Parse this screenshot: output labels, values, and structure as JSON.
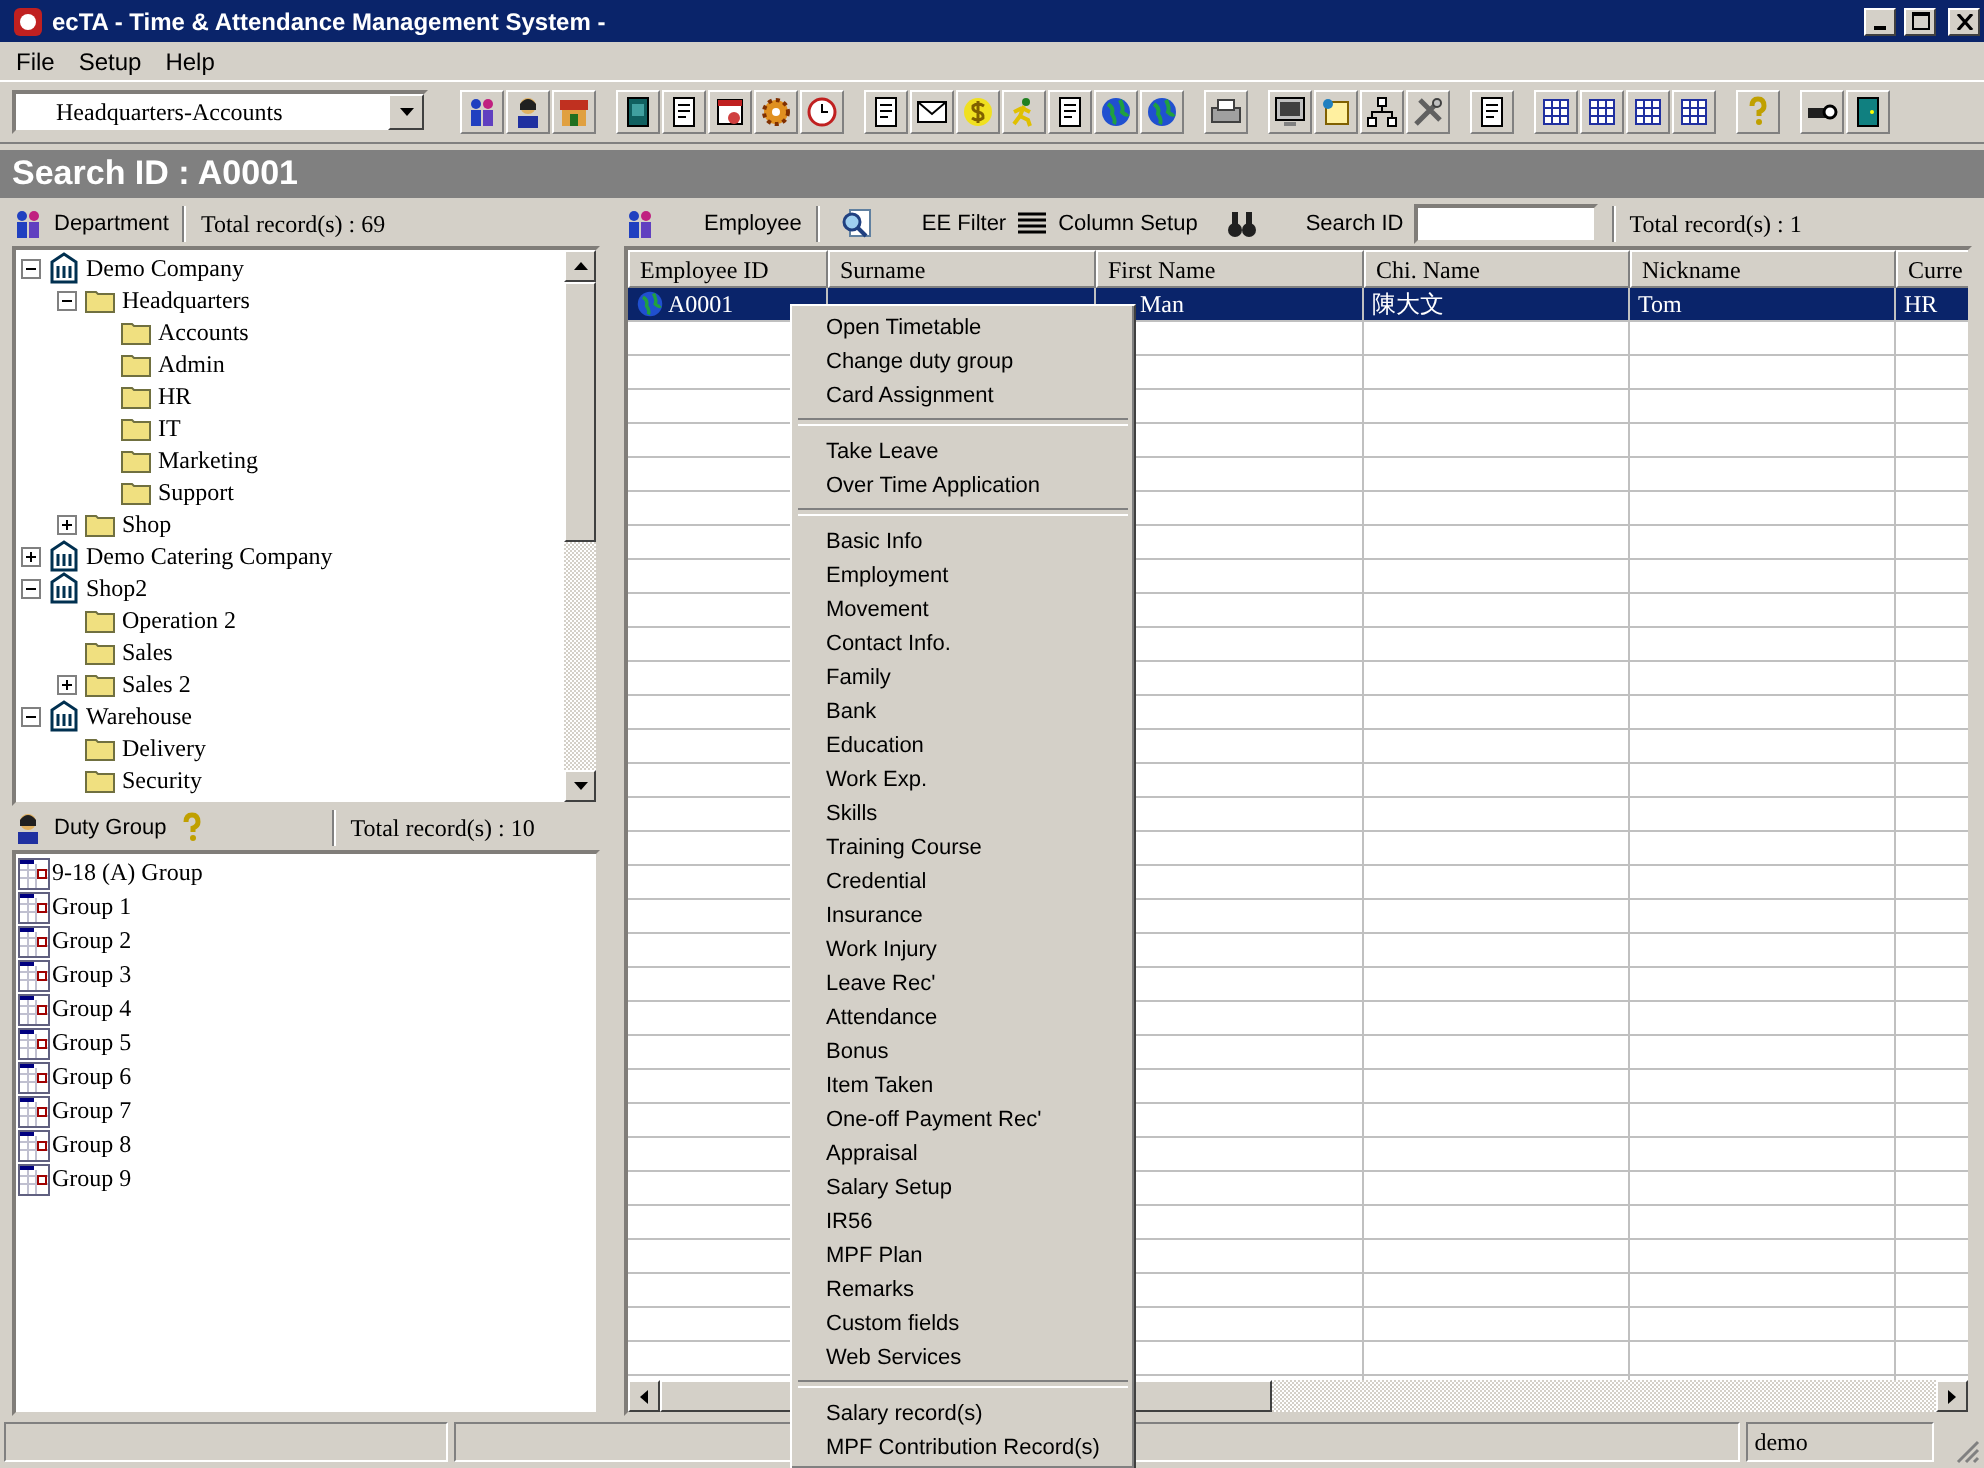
{
  "window": {
    "title": "ecTA - Time & Attendance Management System -"
  },
  "menu_bar": [
    "File",
    "Setup",
    "Help"
  ],
  "department_selector": {
    "value": "Headquarters-Accounts"
  },
  "search_header": "Search ID : A0001",
  "department_panel": {
    "label": "Department",
    "total": "Total record(s) : 69",
    "tree": [
      {
        "label": "Demo Company",
        "kind": "company",
        "expanded": true,
        "children": [
          {
            "label": "Headquarters",
            "kind": "folder",
            "expanded": true,
            "children": [
              {
                "label": "Accounts",
                "kind": "folder"
              },
              {
                "label": "Admin",
                "kind": "folder"
              },
              {
                "label": "HR",
                "kind": "folder"
              },
              {
                "label": "IT",
                "kind": "folder"
              },
              {
                "label": "Marketing",
                "kind": "folder"
              },
              {
                "label": "Support",
                "kind": "folder"
              }
            ]
          },
          {
            "label": "Shop",
            "kind": "folder",
            "expanded": false
          }
        ]
      },
      {
        "label": "Demo Catering Company",
        "kind": "company",
        "expanded": false
      },
      {
        "label": "Shop2",
        "kind": "company",
        "expanded": true,
        "children": [
          {
            "label": "Operation 2",
            "kind": "folder"
          },
          {
            "label": "Sales",
            "kind": "folder"
          },
          {
            "label": "Sales 2",
            "kind": "folder",
            "expanded": false
          }
        ]
      },
      {
        "label": "Warehouse",
        "kind": "company",
        "expanded": true,
        "children": [
          {
            "label": "Delivery",
            "kind": "folder"
          },
          {
            "label": "Security",
            "kind": "folder"
          }
        ]
      }
    ]
  },
  "duty_group_panel": {
    "label": "Duty Group",
    "total": "Total record(s) : 10",
    "items": [
      "9-18 (A) Group",
      "Group 1",
      "Group 2",
      "Group 3",
      "Group 4",
      "Group 5",
      "Group 6",
      "Group 7",
      "Group 8",
      "Group 9"
    ]
  },
  "employee_panel": {
    "label": "Employee",
    "filter_button": "EE Filter",
    "column_setup_button": "Column Setup",
    "search_label": "Search ID",
    "total": "Total record(s) : 1",
    "table": {
      "columns": [
        "Employee ID",
        "Surname",
        "First Name",
        "Chi. Name",
        "Nickname",
        "Curre"
      ],
      "rows": [
        {
          "selected": true,
          "employee_id": "A0001",
          "first_name": "Man",
          "chi_name": "陳大文",
          "nickname": "Tom",
          "column_6": "HR"
        }
      ]
    }
  },
  "context_menu": [
    [
      "Open Timetable",
      "Change duty group",
      "Card Assignment"
    ],
    [
      "Take Leave",
      "Over Time Application"
    ],
    [
      "Basic Info",
      "Employment",
      "Movement",
      "Contact Info.",
      "Family",
      "Bank",
      "Education",
      "Work Exp.",
      "Skills",
      "Training Course",
      "Credential",
      "Insurance",
      "Work Injury",
      "Leave Rec'",
      "Attendance",
      "Bonus",
      "Item Taken",
      "One-off Payment Rec'",
      "Appraisal",
      "Salary Setup",
      "IR56",
      "MPF Plan",
      "Remarks",
      "Custom fields",
      "Web Services"
    ],
    [
      "Salary record(s)",
      "MPF Contribution Record(s)"
    ]
  ],
  "status_bar": {
    "user": "demo"
  }
}
